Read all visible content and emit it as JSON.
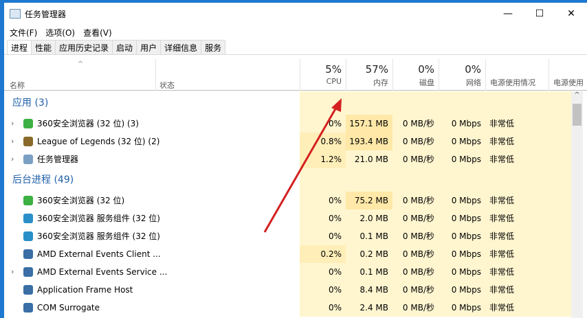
{
  "window": {
    "title": "任务管理器",
    "minimize": "—",
    "maximize": "☐",
    "close": "✕"
  },
  "menu": [
    "文件(F)",
    "选项(O)",
    "查看(V)"
  ],
  "tabs": [
    "进程",
    "性能",
    "应用历史记录",
    "启动",
    "用户",
    "详细信息",
    "服务"
  ],
  "columns": {
    "name": "名称",
    "status": "状态",
    "cpu": {
      "pct": "5%",
      "label": "CPU"
    },
    "mem": {
      "pct": "57%",
      "label": "内存"
    },
    "disk": {
      "pct": "0%",
      "label": "磁盘"
    },
    "net": {
      "pct": "0%",
      "label": "网络"
    },
    "power": "电源使用情况",
    "power_trend": "电源使用"
  },
  "groups": [
    {
      "title": "应用 (3)",
      "rows": [
        {
          "name": "360安全浏览器 (32 位) (3)",
          "expand": true,
          "icon": "#3cb043",
          "cpu": "0%",
          "mem": "157.1 MB",
          "disk": "0 MB/秒",
          "net": "0 Mbps",
          "power": "非常低"
        },
        {
          "name": "League of Legends (32 位) (2)",
          "expand": true,
          "icon": "#8a6a2a",
          "cpu": "0.8%",
          "mem": "193.4 MB",
          "disk": "0 MB/秒",
          "net": "0 Mbps",
          "power": "非常低"
        },
        {
          "name": "任务管理器",
          "expand": true,
          "icon": "#7aa0c4",
          "cpu": "1.2%",
          "mem": "21.0 MB",
          "disk": "0 MB/秒",
          "net": "0 Mbps",
          "power": "非常低"
        }
      ]
    },
    {
      "title": "后台进程 (49)",
      "rows": [
        {
          "name": "360安全浏览器 (32 位)",
          "expand": false,
          "icon": "#3cb043",
          "cpu": "0%",
          "mem": "75.2 MB",
          "disk": "0 MB/秒",
          "net": "0 Mbps",
          "power": "非常低"
        },
        {
          "name": "360安全浏览器 服务组件 (32 位)",
          "expand": false,
          "icon": "#2a8fc8",
          "cpu": "0%",
          "mem": "2.0 MB",
          "disk": "0 MB/秒",
          "net": "0 Mbps",
          "power": "非常低"
        },
        {
          "name": "360安全浏览器 服务组件 (32 位)",
          "expand": false,
          "icon": "#2a8fc8",
          "cpu": "0%",
          "mem": "0.1 MB",
          "disk": "0 MB/秒",
          "net": "0 Mbps",
          "power": "非常低"
        },
        {
          "name": "AMD External Events Client ...",
          "expand": false,
          "icon": "#3a6ea5",
          "cpu": "0.2%",
          "mem": "0.2 MB",
          "disk": "0 MB/秒",
          "net": "0 Mbps",
          "power": "非常低"
        },
        {
          "name": "AMD External Events Service ...",
          "expand": true,
          "icon": "#3a6ea5",
          "cpu": "0%",
          "mem": "0.1 MB",
          "disk": "0 MB/秒",
          "net": "0 Mbps",
          "power": "非常低"
        },
        {
          "name": "Application Frame Host",
          "expand": false,
          "icon": "#3a6ea5",
          "cpu": "0%",
          "mem": "8.4 MB",
          "disk": "0 MB/秒",
          "net": "0 Mbps",
          "power": "非常低"
        },
        {
          "name": "COM Surrogate",
          "expand": false,
          "icon": "#3a6ea5",
          "cpu": "0%",
          "mem": "2.4 MB",
          "disk": "0 MB/秒",
          "net": "0 Mbps",
          "power": "非常低"
        }
      ]
    }
  ],
  "colors": {
    "arrow": "#d42020",
    "heat": "#fff6d0",
    "heat_mem": "#ffe8a8"
  }
}
